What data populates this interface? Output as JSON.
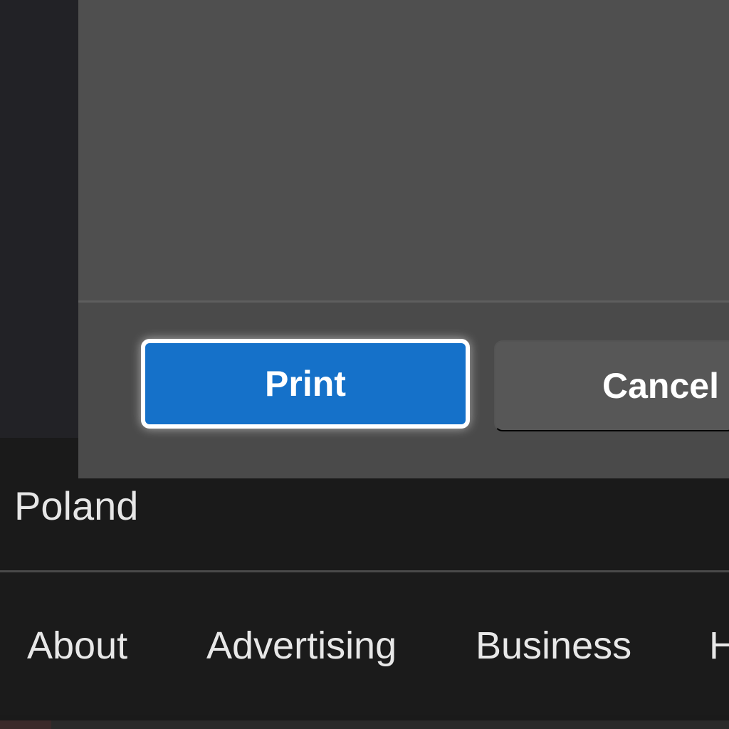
{
  "dialog": {
    "print_label": "Print",
    "cancel_label": "Cancel",
    "print_color": "#1571c9"
  },
  "page": {
    "country": "Poland"
  },
  "footer": {
    "links": [
      {
        "label": "About"
      },
      {
        "label": "Advertising"
      },
      {
        "label": "Business"
      },
      {
        "label": "H"
      }
    ]
  }
}
